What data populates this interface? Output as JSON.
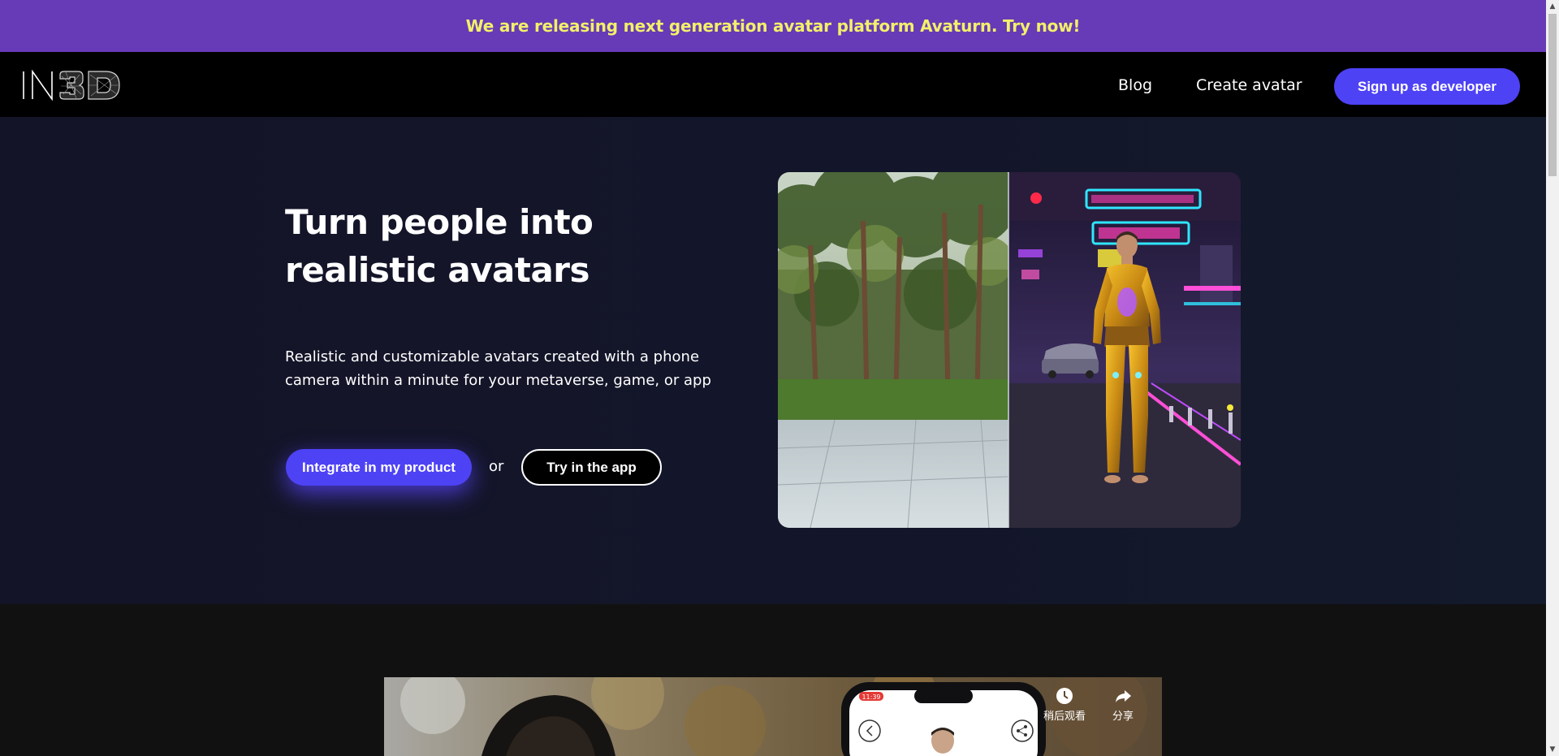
{
  "banner": {
    "text": "We are releasing next generation avatar platform Avaturn. Try now!",
    "text_color": "#f2f06a",
    "background": "#673ab7"
  },
  "header": {
    "logo_alt": "IN3D",
    "nav": {
      "blog": "Blog",
      "create_avatar": "Create avatar"
    },
    "signup_button": "Sign up as developer"
  },
  "hero": {
    "title": "Turn people into realistic avatars",
    "subtitle": "Realistic and customizable avatars created with a phone camera within a minute for your metaverse, game, or app",
    "primary_button": "Integrate in my product",
    "or_text": "or",
    "secondary_button": "Try in the app"
  },
  "video": {
    "phone_time": "11:39",
    "watch_later": "稍后观看",
    "share": "分享"
  },
  "colors": {
    "accent": "#4e42f5",
    "hero_bg": "#13142a",
    "page_bg": "#111111"
  },
  "icons": {
    "watch_later": "clock-icon",
    "share": "share-icon",
    "scroll_up": "triangle-up-icon",
    "scroll_down": "triangle-down-icon"
  }
}
